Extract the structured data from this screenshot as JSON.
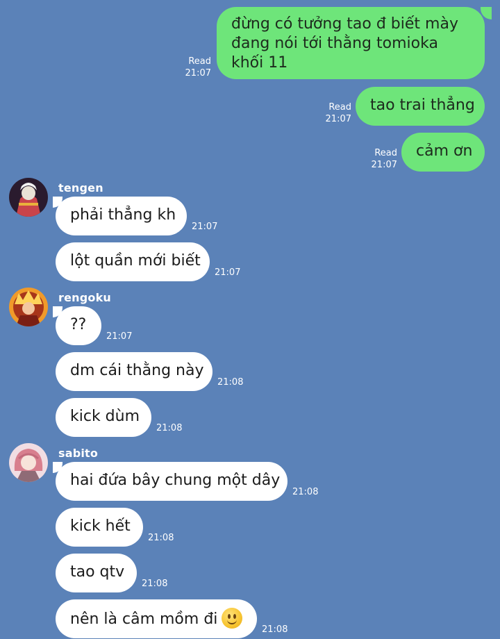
{
  "outgoing": [
    {
      "text": "đừng có tưởng tao đ biết mày đang nói tới thằng tomioka khối 11",
      "status": "Read",
      "time": "21:07"
    },
    {
      "text": "tao trai thẳng",
      "status": "Read",
      "time": "21:07"
    },
    {
      "text": "cảm ơn",
      "status": "Read",
      "time": "21:07"
    }
  ],
  "senders": [
    {
      "name": "tengen",
      "avatar_colors": [
        "#2a1b2e",
        "#c9444b",
        "#e9e2d6"
      ],
      "messages": [
        {
          "text": "phải thẳng kh",
          "time": "21:07"
        },
        {
          "text": "lột quần mới biết",
          "time": "21:07"
        }
      ]
    },
    {
      "name": "rengoku",
      "avatar_colors": [
        "#a8361a",
        "#f09a2a",
        "#ffd35a"
      ],
      "messages": [
        {
          "text": "??",
          "time": "21:07"
        },
        {
          "text": "dm cái thằng này",
          "time": "21:08"
        },
        {
          "text": "kick dùm",
          "time": "21:08"
        }
      ]
    },
    {
      "name": "sabito",
      "avatar_colors": [
        "#f1dde3",
        "#d87f8e",
        "#8f6b76"
      ],
      "messages": [
        {
          "text": "hai đứa bây chung một dây",
          "time": "21:08"
        },
        {
          "text": "kick hết",
          "time": "21:08"
        },
        {
          "text": "tao qtv",
          "time": "21:08"
        },
        {
          "text": "nên là câm mồm đi",
          "time": "21:08",
          "emoji": "slightly-smiling-face"
        }
      ]
    }
  ],
  "colors": {
    "background": "#5b82b8",
    "outgoing_bubble": "#6ee57a",
    "incoming_bubble": "#ffffff"
  }
}
